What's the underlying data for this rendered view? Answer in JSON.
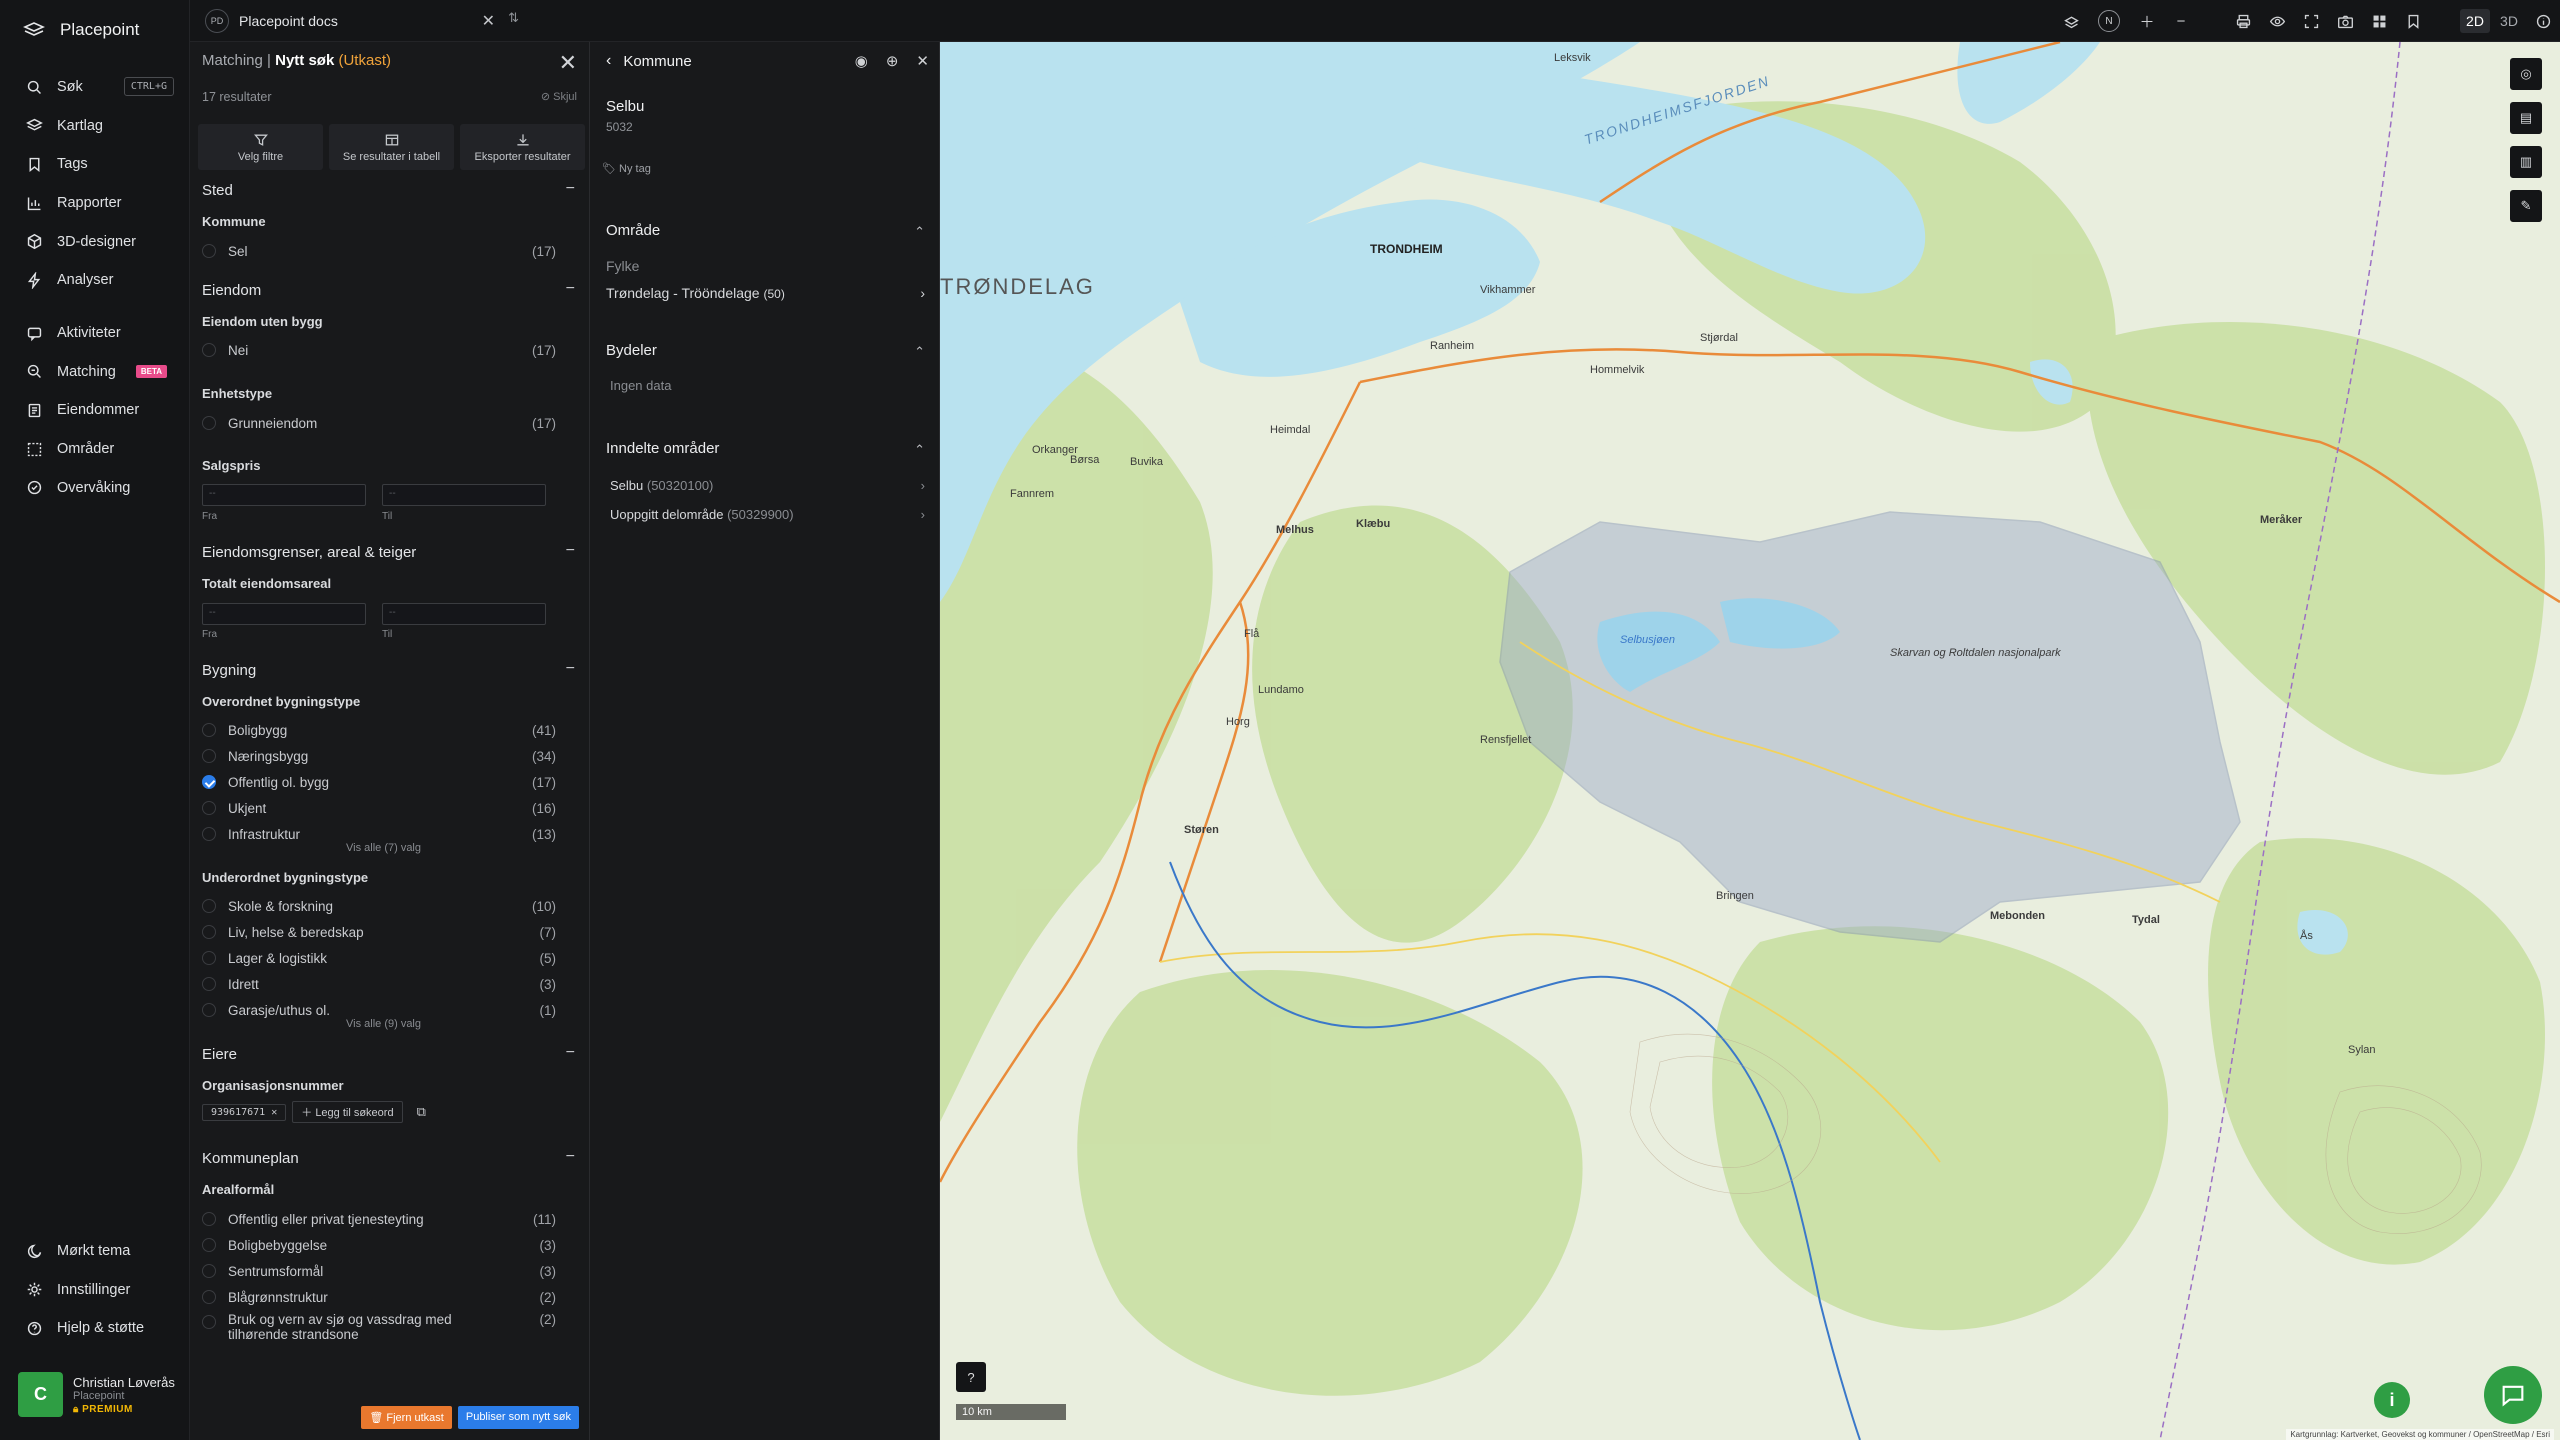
{
  "app": {
    "name": "Placepoint"
  },
  "sidebar": {
    "items": [
      {
        "label": "Søk",
        "shortcut": "CTRL+G"
      },
      {
        "label": "Kartlag"
      },
      {
        "label": "Tags"
      },
      {
        "label": "Rapporter"
      },
      {
        "label": "3D-designer"
      },
      {
        "label": "Analyser"
      },
      {
        "label": "Aktiviteter"
      },
      {
        "label": "Matching",
        "badge": "BETA"
      },
      {
        "label": "Eiendommer"
      },
      {
        "label": "Områder"
      },
      {
        "label": "Overvåking"
      }
    ],
    "bottom": [
      {
        "label": "Mørkt tema"
      },
      {
        "label": "Innstillinger"
      },
      {
        "label": "Hjelp & støtte"
      }
    ],
    "user": {
      "initial": "C",
      "name": "Christian Løverås",
      "org": "Placepoint",
      "plan": "PREMIUM"
    }
  },
  "topbar": {
    "doc_badge": "PD",
    "doc_title": "Placepoint docs",
    "mode_2d": "2D",
    "mode_3d": "3D",
    "compass": "N"
  },
  "filters": {
    "crumb": "Matching",
    "sep": "|",
    "title": "Nytt søk",
    "status": "(Utkast)",
    "result_count": "17 resultater",
    "hide_label": "Skjul",
    "buttons": [
      "Velg filtre",
      "Se resultater i tabell",
      "Eksporter resultater"
    ],
    "sted": {
      "title": "Sted",
      "kommune_label": "Kommune",
      "options": [
        {
          "label": "Sel",
          "count": "(17)"
        }
      ]
    },
    "eiendom": {
      "title": "Eiendom",
      "uten_bygg_label": "Eiendom uten bygg",
      "uten_bygg_options": [
        {
          "label": "Nei",
          "count": "(17)"
        }
      ],
      "enhetstype_label": "Enhetstype",
      "enhetstype_options": [
        {
          "label": "Grunneiendom",
          "count": "(17)"
        }
      ],
      "salgspris_label": "Salgspris",
      "from": "Fra",
      "to": "Til",
      "placeholder": "--"
    },
    "grenser": {
      "title": "Eiendomsgrenser, areal & teiger",
      "areal_label": "Totalt eiendomsareal",
      "from": "Fra",
      "to": "Til",
      "placeholder": "--"
    },
    "bygning": {
      "title": "Bygning",
      "overordnet_label": "Overordnet bygningstype",
      "overordnet": [
        {
          "label": "Boligbygg",
          "count": "(41)",
          "checked": false
        },
        {
          "label": "Næringsbygg",
          "count": "(34)",
          "checked": false
        },
        {
          "label": "Offentlig ol. bygg",
          "count": "(17)",
          "checked": true
        },
        {
          "label": "Ukjent",
          "count": "(16)",
          "checked": false
        },
        {
          "label": "Infrastruktur",
          "count": "(13)",
          "checked": false
        }
      ],
      "overordnet_more": "Vis alle (7) valg",
      "underordnet_label": "Underordnet bygningstype",
      "underordnet": [
        {
          "label": "Skole & forskning",
          "count": "(10)"
        },
        {
          "label": "Liv, helse & beredskap",
          "count": "(7)"
        },
        {
          "label": "Lager & logistikk",
          "count": "(5)"
        },
        {
          "label": "Idrett",
          "count": "(3)"
        },
        {
          "label": "Garasje/uthus ol.",
          "count": "(1)"
        }
      ],
      "underordnet_more": "Vis alle (9) valg"
    },
    "eiere": {
      "title": "Eiere",
      "org_label": "Organisasjonsnummer",
      "org_value": "939617671",
      "add_keyword": "Legg til søkeord"
    },
    "kommuneplan": {
      "title": "Kommuneplan",
      "arealformal_label": "Arealformål",
      "options": [
        {
          "label": "Offentlig eller privat tjenesteyting",
          "count": "(11)"
        },
        {
          "label": "Boligbebyggelse",
          "count": "(3)"
        },
        {
          "label": "Sentrumsformål",
          "count": "(3)"
        },
        {
          "label": "Blågrønnstruktur",
          "count": "(2)"
        },
        {
          "label": "Bruk og vern av sjø og vassdrag med",
          "label2": "tilhørende strandsone",
          "count": "(2)"
        }
      ]
    },
    "footer": {
      "remove": "Fjern utkast",
      "publish": "Publiser som nytt søk"
    }
  },
  "kommune": {
    "header": "Kommune",
    "name": "Selbu",
    "code": "5032",
    "tag": "Ny tag",
    "omrade": {
      "title": "Område",
      "fylke_label": "Fylke",
      "fylke_value": "Trøndelag - Trööndelage",
      "fylke_count": "(50)"
    },
    "bydeler": {
      "title": "Bydeler",
      "empty": "Ingen data"
    },
    "inndelte": {
      "title": "Inndelte områder",
      "items": [
        {
          "name": "Selbu",
          "code": "(50320100)"
        },
        {
          "name": "Uoppgitt delområde",
          "code": "(50329900)"
        }
      ]
    }
  },
  "map": {
    "scale": "10 km",
    "attribution": "Kartgrunnlag: Kartverket, Geovekst og kommuner / OpenStreetMap / Esri",
    "labels": [
      "TRØNDELAG",
      "TRONDHEIM",
      "TRONDHEIMSFJORDEN",
      "Selbusjøen",
      "Skarvan og Roltdalen nasjonalpark",
      "Leksvik",
      "Melhus",
      "Klæbu",
      "Hommelvik",
      "Stjørdal",
      "Vikhammer",
      "Ranheim",
      "Heimdal",
      "Børsa",
      "Buvika",
      "Orkanger",
      "Fannrem",
      "Støren",
      "Horg",
      "Lundamo",
      "Flå",
      "Mebonden",
      "Tydal",
      "Ås",
      "Meråker",
      "Bringen",
      "Rensfjellet",
      "Sylan"
    ],
    "colors": {
      "land": "#e9eede",
      "forest": "#c9dfa3",
      "water": "#b9e2ef",
      "selection": "#9aa9c8"
    }
  }
}
